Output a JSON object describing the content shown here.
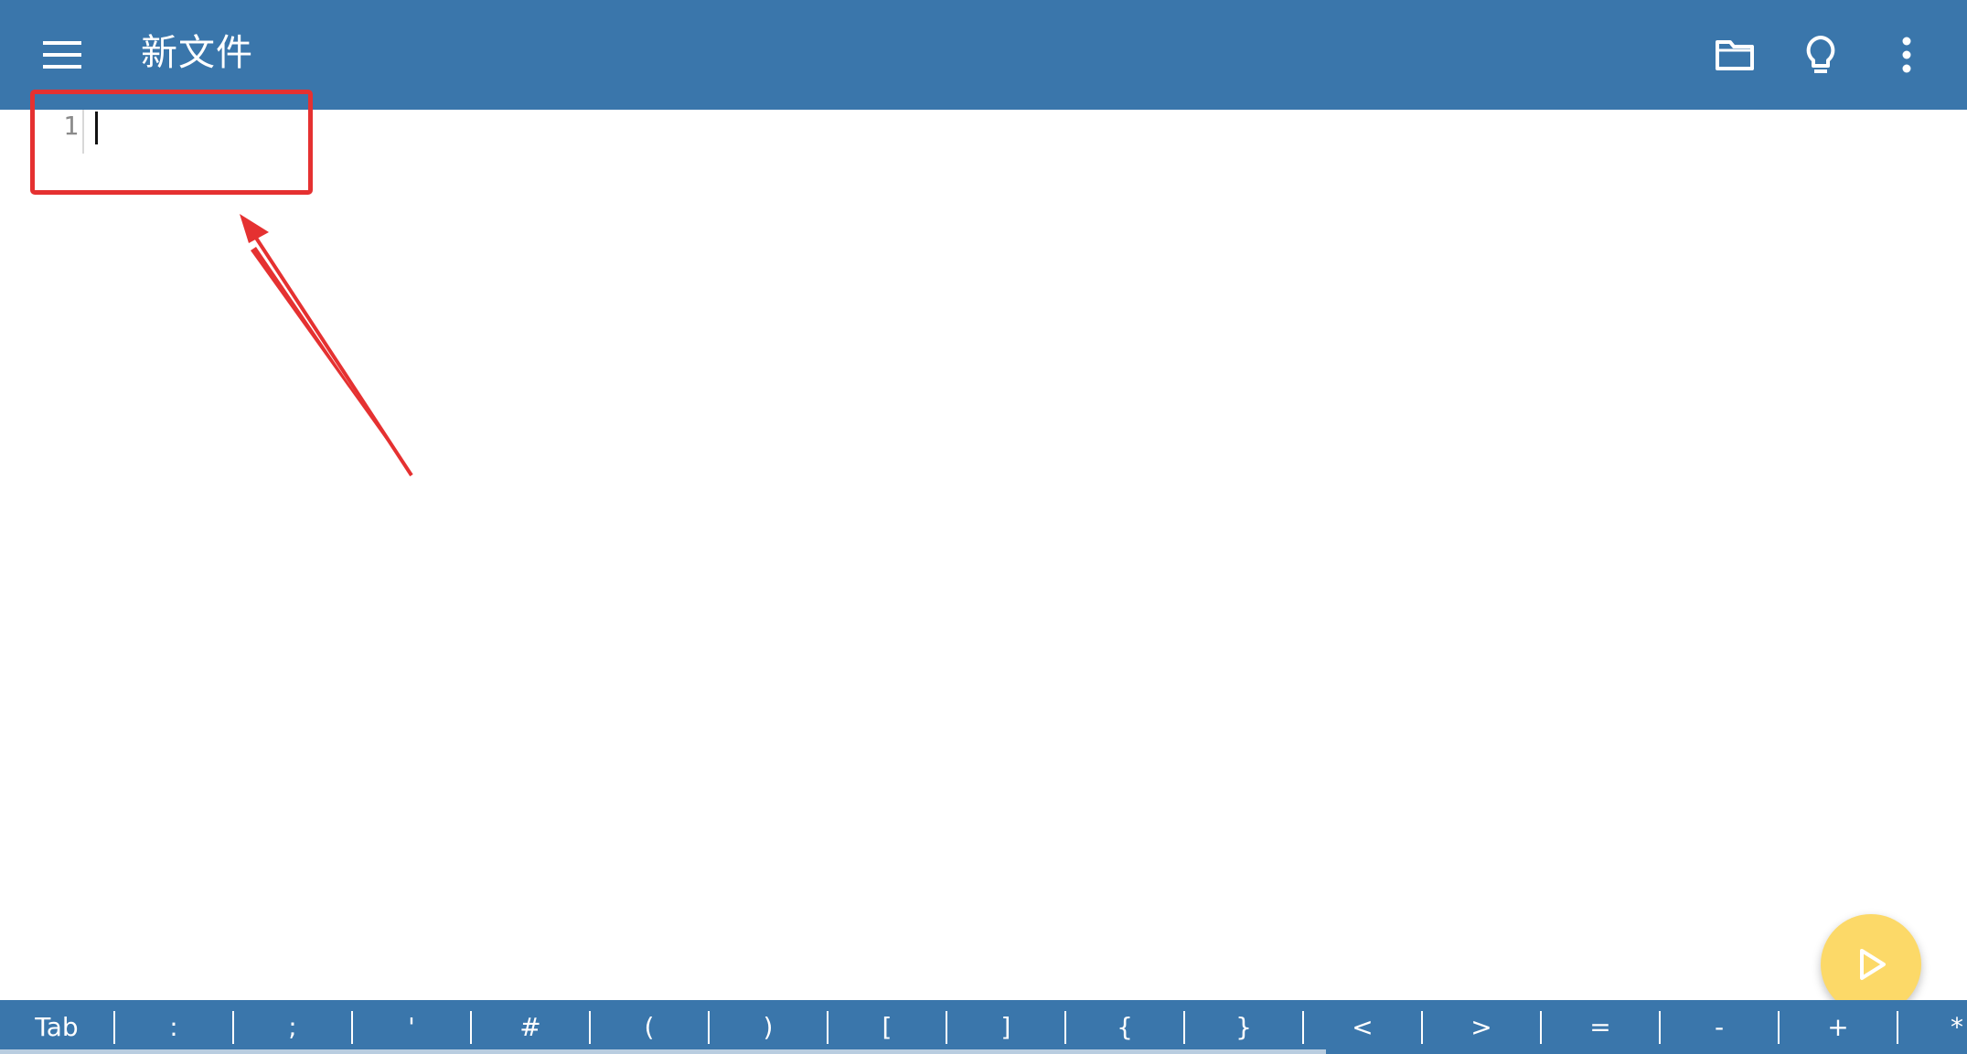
{
  "appbar": {
    "title": "新文件",
    "menu_icon": "hamburger-menu-icon",
    "folder_icon": "folder-icon",
    "bulb_icon": "lightbulb-icon",
    "more_icon": "more-vert-icon",
    "color": "#3a76ab"
  },
  "editor": {
    "line_numbers": [
      "1"
    ],
    "content": ""
  },
  "fab": {
    "icon": "play-icon",
    "color": "#fcd968"
  },
  "symbol_bar": {
    "keys": [
      "Tab",
      ":",
      ";",
      "'",
      "#",
      "(",
      ")",
      "[",
      "]",
      "{",
      "}",
      "<",
      ">",
      "=",
      "-",
      "+",
      "*"
    ]
  },
  "annotation": {
    "box_color": "#e53131"
  }
}
